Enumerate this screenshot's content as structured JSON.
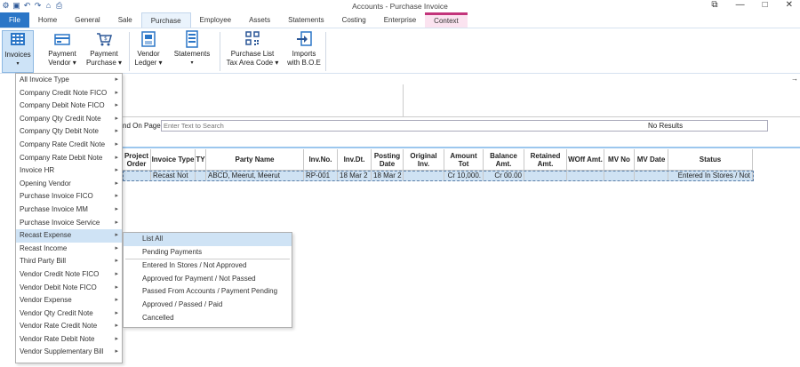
{
  "window": {
    "title": "Accounts - Purchase Invoice",
    "controls": [
      "⧉",
      "—",
      "□",
      "✕"
    ]
  },
  "tabs": [
    {
      "label": "File",
      "kind": "file"
    },
    {
      "label": "Home",
      "kind": ""
    },
    {
      "label": "General",
      "kind": ""
    },
    {
      "label": "Sale",
      "kind": ""
    },
    {
      "label": "Purchase",
      "kind": "active"
    },
    {
      "label": "Employee",
      "kind": ""
    },
    {
      "label": "Assets",
      "kind": ""
    },
    {
      "label": "Statements",
      "kind": ""
    },
    {
      "label": "Costing",
      "kind": ""
    },
    {
      "label": "Enterprise",
      "kind": ""
    },
    {
      "label": "Context",
      "kind": "context"
    }
  ],
  "ribbon": {
    "invoices": {
      "line1": "Invoices",
      "line2": "▾"
    },
    "payment_vendor": {
      "line1": "Payment",
      "line2": "Vendor ▾"
    },
    "payment_purchase": {
      "line1": "Payment",
      "line2": "Purchase ▾"
    },
    "vendor_ledger": {
      "line1": "Vendor",
      "line2": "Ledger ▾"
    },
    "statements": {
      "line1": "Statements",
      "line2": "▾"
    },
    "purchase_list": {
      "line1": "Purchase List",
      "line2": "Tax Area Code ▾"
    },
    "imports": {
      "line1": "Imports",
      "line2": "with B.O.E"
    }
  },
  "search": {
    "label": "nd On Page",
    "placeholder": "Enter Text to Search",
    "results": "No Results"
  },
  "table": {
    "headers": [
      "Project Order",
      "Invoice Type",
      "TY",
      "Party Name",
      "Inv.No.",
      "Inv.Dt.",
      "Posting Date",
      "Original Inv.",
      "Amount Tot",
      "Balance Amt.",
      "Retained Amt.",
      "WOff Amt.",
      "MV No",
      "MV Date",
      "Status"
    ],
    "rows": [
      [
        "",
        "Recast Not",
        "",
        "ABCD, Meerut, Meerut",
        "RP-001",
        "18 Mar 2",
        "18 Mar 2",
        "",
        "Cr 10,000.",
        "Cr 00.00",
        "",
        "",
        "",
        "",
        "Entered In Stores / Not"
      ]
    ]
  },
  "menu": {
    "items": [
      {
        "label": "All Invoice Type",
        "sub": true
      },
      {
        "label": "Company Credit Note FICO",
        "sub": true
      },
      {
        "label": "Company Debit Note FICO",
        "sub": true
      },
      {
        "label": "Company Qty Credit Note",
        "sub": true
      },
      {
        "label": "Company Qty Debit Note",
        "sub": true
      },
      {
        "label": "Company Rate Credit Note",
        "sub": true
      },
      {
        "label": "Company Rate Debit Note",
        "sub": true
      },
      {
        "label": "Invoice HR",
        "sub": true
      },
      {
        "label": "Opening Vendor",
        "sub": true
      },
      {
        "label": "Purchase Invoice FICO",
        "sub": true
      },
      {
        "label": "Purchase Invoice MM",
        "sub": true
      },
      {
        "label": "Purchase Invoice Service",
        "sub": true
      },
      {
        "label": "Recast Expense",
        "sub": true,
        "highlight": true
      },
      {
        "label": "Recast Income",
        "sub": true
      },
      {
        "label": "Third Party Bill",
        "sub": true
      },
      {
        "label": "Vendor Credit Note FICO",
        "sub": true
      },
      {
        "label": "Vendor Debit Note FICO",
        "sub": true
      },
      {
        "label": "Vendor Expense",
        "sub": true
      },
      {
        "label": "Vendor Qty Credit Note",
        "sub": true
      },
      {
        "label": "Vendor Rate Credit Note",
        "sub": true
      },
      {
        "label": "Vendor Rate Debit Note",
        "sub": true
      },
      {
        "label": "Vendor Supplementary Bill",
        "sub": true
      }
    ]
  },
  "submenu": {
    "items": [
      {
        "label": "List All",
        "highlight": true
      },
      {
        "label": "Pending Payments"
      },
      {
        "divider": true
      },
      {
        "label": "Entered In Stores / Not Approved"
      },
      {
        "label": "Approved for Payment / Not Passed"
      },
      {
        "label": "Passed From Accounts / Payment Pending"
      },
      {
        "label": "Approved / Passed / Paid"
      },
      {
        "label": "Cancelled"
      }
    ]
  },
  "colors": {
    "accent": "#2b76c7",
    "selection": "#cfe2f3",
    "context_tab": "#c3347b"
  }
}
